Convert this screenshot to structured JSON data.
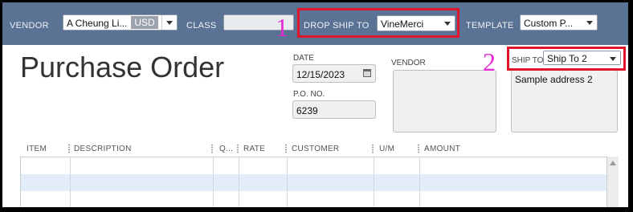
{
  "toolbar": {
    "vendor_label": "VENDOR",
    "vendor_value": "A Cheung Li...",
    "currency": "USD",
    "class_label": "CLASS",
    "class_value": "",
    "drop_ship_label": "DROP SHIP TO",
    "drop_ship_value": "VineMerci",
    "template_label": "TEMPLATE",
    "template_value": "Custom P..."
  },
  "form": {
    "title": "Purchase Order",
    "date_label": "DATE",
    "date_value": "12/15/2023",
    "po_label": "P.O. NO.",
    "po_value": "6239",
    "vendor_label": "VENDOR",
    "vendor_address": "",
    "ship_to_label": "SHIP TO",
    "ship_to_value": "Ship To 2",
    "ship_to_address": "Sample address 2"
  },
  "table": {
    "columns": [
      "ITEM",
      "DESCRIPTION",
      "Q...",
      "RATE",
      "CUSTOMER",
      "U/M",
      "AMOUNT"
    ],
    "rows": [
      [
        "",
        "",
        "",
        "",
        "",
        "",
        ""
      ],
      [
        "",
        "",
        "",
        "",
        "",
        "",
        ""
      ],
      [
        "",
        "",
        "",
        "",
        "",
        "",
        ""
      ]
    ]
  },
  "annotations": {
    "callout_1": "1",
    "callout_2": "2"
  },
  "colors": {
    "toolbar_bg": "#5a7394",
    "highlight_red": "#e0142b",
    "callout_magenta": "#e62bd4",
    "row_alt": "#e3ecf9"
  }
}
